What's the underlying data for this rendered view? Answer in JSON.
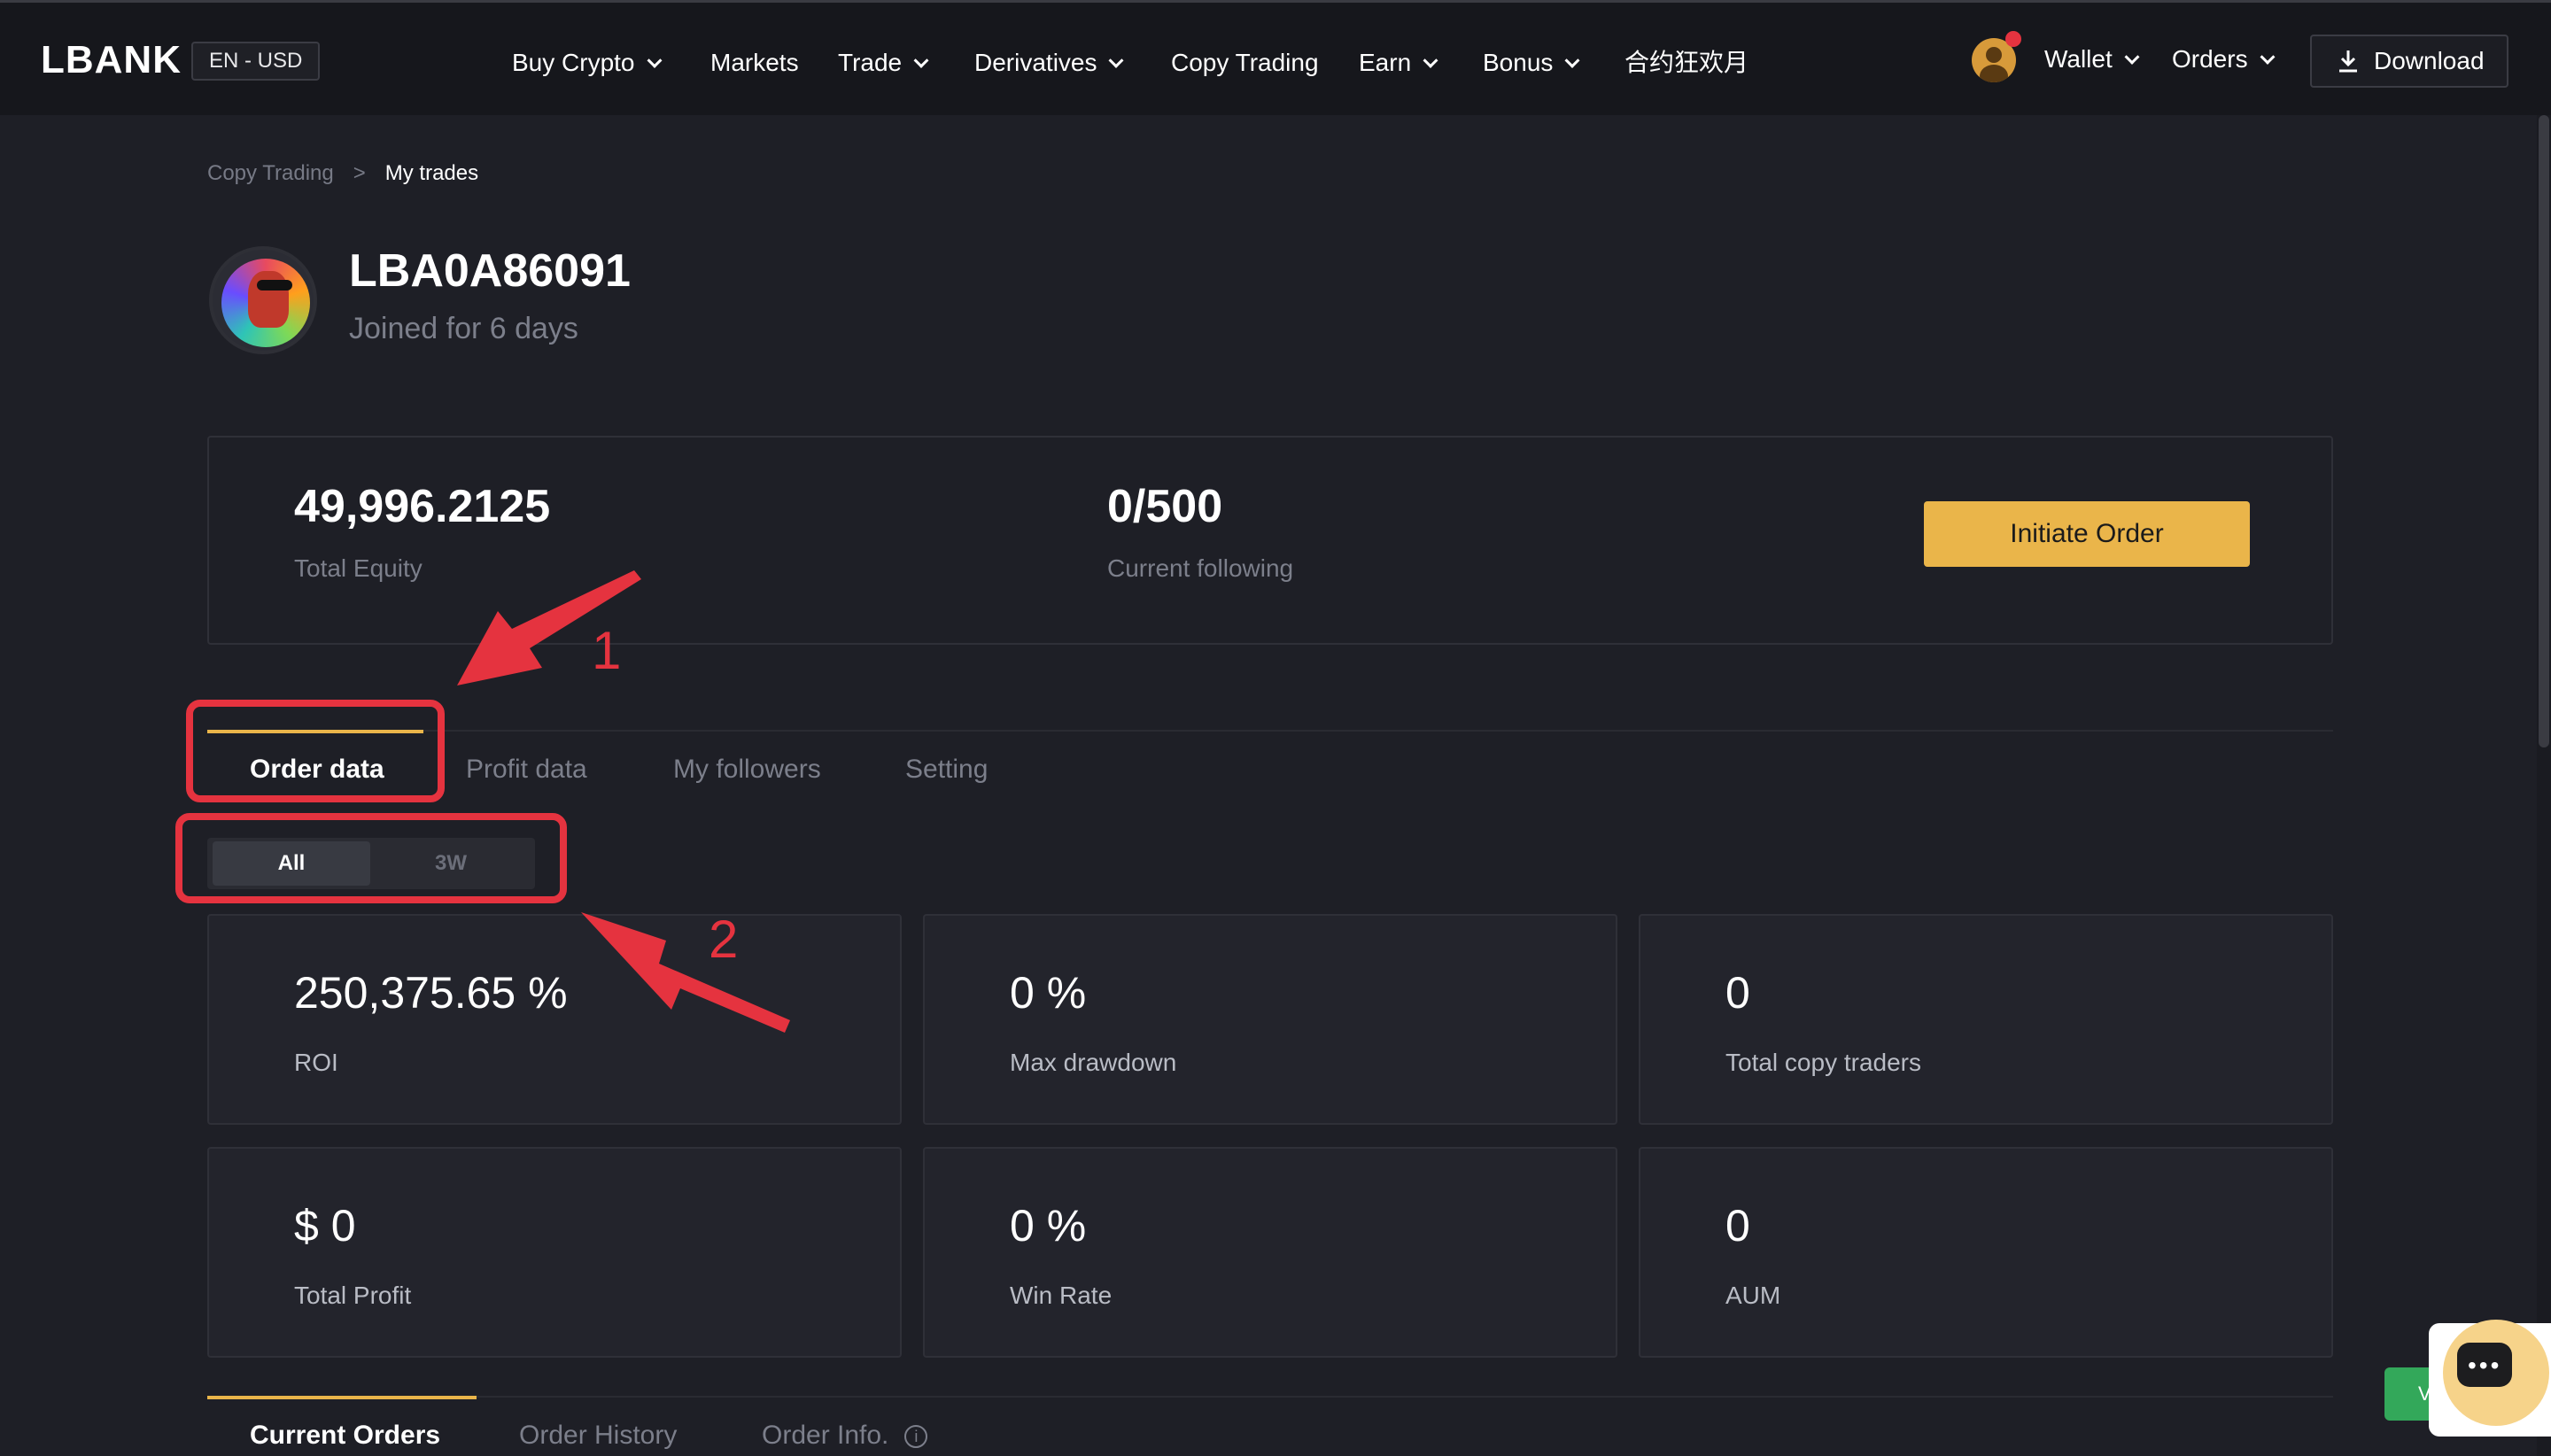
{
  "header": {
    "logo": "LBANK",
    "lang_currency": "EN - USD",
    "nav": [
      {
        "label": "Buy Crypto",
        "dropdown": true
      },
      {
        "label": "Markets",
        "dropdown": false
      },
      {
        "label": "Trade",
        "dropdown": true
      },
      {
        "label": "Derivatives",
        "dropdown": true
      },
      {
        "label": "Copy Trading",
        "dropdown": false
      },
      {
        "label": "Earn",
        "dropdown": true
      },
      {
        "label": "Bonus",
        "dropdown": true
      },
      {
        "label": "合约狂欢月",
        "dropdown": false
      }
    ],
    "wallet_label": "Wallet",
    "orders_label": "Orders",
    "download_label": "Download"
  },
  "breadcrumb": {
    "parent": "Copy Trading",
    "separator": ">",
    "current": "My trades"
  },
  "profile": {
    "username": "LBA0A86091",
    "joined": "Joined for 6 days"
  },
  "summary": {
    "total_equity_value": "49,996.2125",
    "total_equity_label": "Total Equity",
    "following_value": "0/500",
    "following_label": "Current following",
    "initiate_button": "Initiate Order"
  },
  "tabs": [
    {
      "label": "Order data",
      "active": true
    },
    {
      "label": "Profit data",
      "active": false
    },
    {
      "label": "My followers",
      "active": false
    },
    {
      "label": "Setting",
      "active": false
    }
  ],
  "range": {
    "options": [
      "All",
      "3W"
    ],
    "selected": "All"
  },
  "metrics": [
    {
      "value": "250,375.65 %",
      "label": "ROI"
    },
    {
      "value": "0 %",
      "label": "Max drawdown"
    },
    {
      "value": "0",
      "label": "Total copy traders"
    },
    {
      "value": "$ 0",
      "label": "Total Profit"
    },
    {
      "value": "0 %",
      "label": "Win Rate"
    },
    {
      "value": "0",
      "label": "AUM"
    }
  ],
  "bottom_tabs": [
    {
      "label": "Current Orders",
      "active": true
    },
    {
      "label": "Order History",
      "active": false
    },
    {
      "label": "Order Info.",
      "active": false
    }
  ],
  "annotations": {
    "label_1": "1",
    "label_2": "2",
    "color": "#e5333f"
  },
  "colors": {
    "accent": "#eab54a",
    "background": "#1e1f26",
    "topbar": "#16171c",
    "card": "#23242c",
    "annotation": "#e5333f"
  },
  "icons": [
    "chevron-down-icon",
    "download-icon",
    "user-avatar-icon",
    "info-icon",
    "chat-icon"
  ]
}
